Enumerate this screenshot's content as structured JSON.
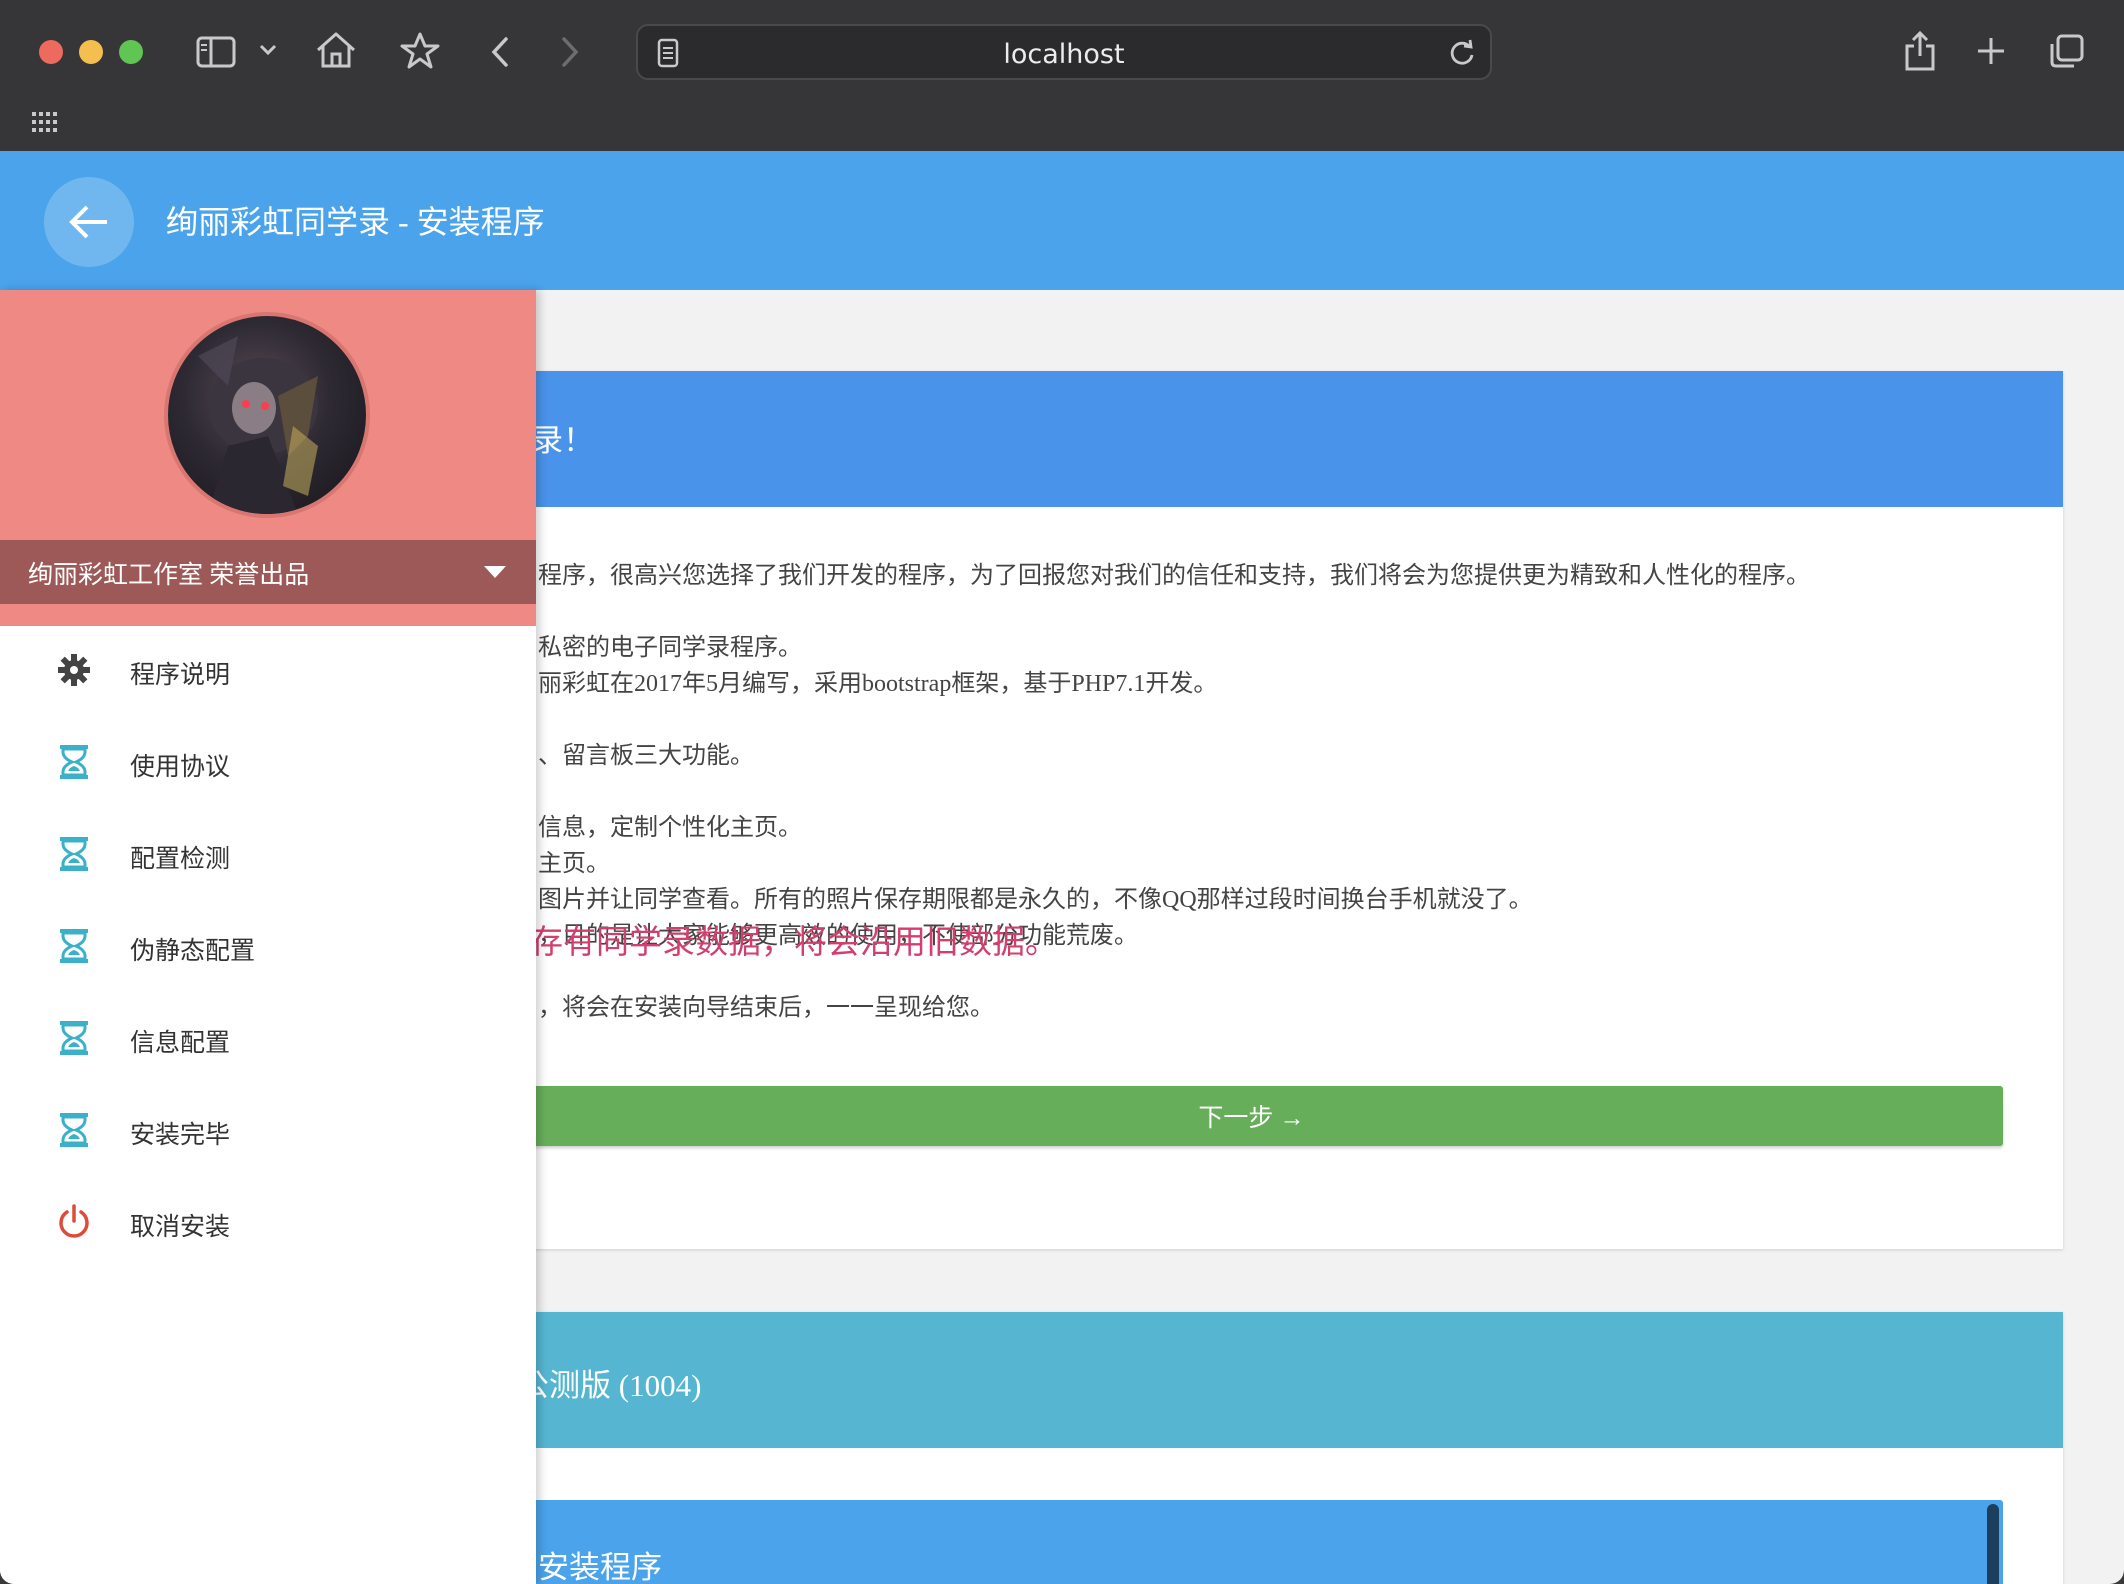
{
  "browser": {
    "url": "localhost"
  },
  "app": {
    "title": "绚丽彩虹同学录 - 安装程序"
  },
  "drawer": {
    "studio_label": "绚丽彩虹工作室 荣誉出品",
    "items": [
      {
        "label": "程序说明",
        "icon": "gear-icon"
      },
      {
        "label": "使用协议",
        "icon": "hourglass-icon"
      },
      {
        "label": "配置检测",
        "icon": "hourglass-icon"
      },
      {
        "label": "伪静态配置",
        "icon": "hourglass-icon"
      },
      {
        "label": "信息配置",
        "icon": "hourglass-icon"
      },
      {
        "label": "安装完毕",
        "icon": "hourglass-icon"
      },
      {
        "label": "取消安装",
        "icon": "power-icon"
      }
    ]
  },
  "card1": {
    "title": "录！",
    "lines": [
      "程序，很高兴您选择了我们开发的程序，为了回报您对我们的信任和支持，我们将会为您提供更为精致和人性化的程序。",
      "私密的电子同学录程序。",
      "丽彩虹在2017年5月编写，采用bootstrap框架，基于PHP7.1开发。",
      "、留言板三大功能。",
      "信息，定制个性化主页。",
      "主页。",
      "图片并让同学查看。所有的照片保存期限都是永久的，不像QQ那样过段时间换台手机就没了。",
      "，目的是让大家能够更高效的使用，不使部分功能荒废。",
      "，将会在安装向导结束后，一一呈现给您。"
    ],
    "warning": "存有同学录数据，将会沿用旧数据。",
    "next_button": "下一步 →"
  },
  "card2": {
    "title": "公测版 (1004)",
    "inner_title": "安装程序"
  },
  "colors": {
    "appbar": "#4aa3eb",
    "drawer_header": "#ef8983",
    "next_button": "#67ae5b",
    "warning_text": "#d23f6e"
  }
}
